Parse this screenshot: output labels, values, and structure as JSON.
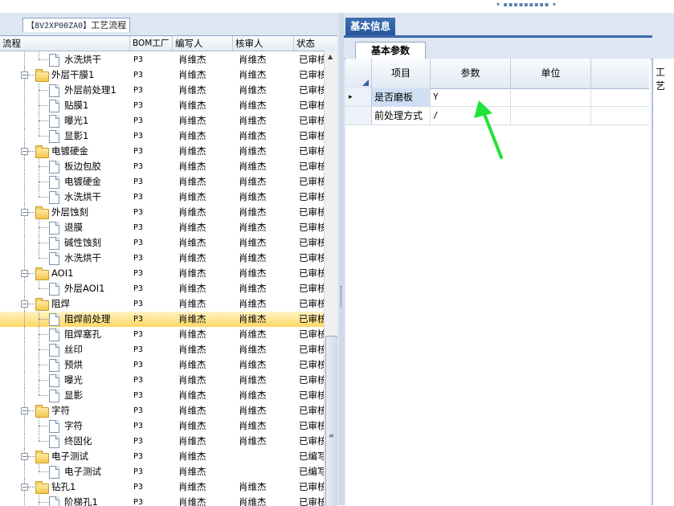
{
  "left_panel": {
    "tab_code": "【8V2XP00ZA0】",
    "tab_label": "工艺流程",
    "columns": [
      "流程",
      "BOM工厂",
      "编写人",
      "核审人",
      "状态"
    ]
  },
  "tree_rows": [
    {
      "level": 2,
      "kind": "doc",
      "name": "水洗烘干",
      "bom": "P3",
      "writer": "肖维杰",
      "reviewer": "肖维杰",
      "status": "已审核",
      "last": true
    },
    {
      "level": 1,
      "kind": "folder",
      "name": "外层干膜1",
      "bom": "P3",
      "writer": "肖维杰",
      "reviewer": "肖维杰",
      "status": "已审核"
    },
    {
      "level": 2,
      "kind": "doc",
      "name": "外层前处理1",
      "bom": "P3",
      "writer": "肖维杰",
      "reviewer": "肖维杰",
      "status": "已审核"
    },
    {
      "level": 2,
      "kind": "doc",
      "name": "贴膜1",
      "bom": "P3",
      "writer": "肖维杰",
      "reviewer": "肖维杰",
      "status": "已审核"
    },
    {
      "level": 2,
      "kind": "doc",
      "name": "曝光1",
      "bom": "P3",
      "writer": "肖维杰",
      "reviewer": "肖维杰",
      "status": "已审核"
    },
    {
      "level": 2,
      "kind": "doc",
      "name": "显影1",
      "bom": "P3",
      "writer": "肖维杰",
      "reviewer": "肖维杰",
      "status": "已审核",
      "last": true
    },
    {
      "level": 1,
      "kind": "folder",
      "name": "电镀硬金",
      "bom": "P3",
      "writer": "肖维杰",
      "reviewer": "肖维杰",
      "status": "已审核"
    },
    {
      "level": 2,
      "kind": "doc",
      "name": "板边包胶",
      "bom": "P3",
      "writer": "肖维杰",
      "reviewer": "肖维杰",
      "status": "已审核"
    },
    {
      "level": 2,
      "kind": "doc",
      "name": "电镀硬金",
      "bom": "P3",
      "writer": "肖维杰",
      "reviewer": "肖维杰",
      "status": "已审核"
    },
    {
      "level": 2,
      "kind": "doc",
      "name": "水洗烘干",
      "bom": "P3",
      "writer": "肖维杰",
      "reviewer": "肖维杰",
      "status": "已审核",
      "last": true
    },
    {
      "level": 1,
      "kind": "folder",
      "name": "外层蚀刻",
      "bom": "P3",
      "writer": "肖维杰",
      "reviewer": "肖维杰",
      "status": "已审核"
    },
    {
      "level": 2,
      "kind": "doc",
      "name": "退膜",
      "bom": "P3",
      "writer": "肖维杰",
      "reviewer": "肖维杰",
      "status": "已审核"
    },
    {
      "level": 2,
      "kind": "doc",
      "name": "碱性蚀刻",
      "bom": "P3",
      "writer": "肖维杰",
      "reviewer": "肖维杰",
      "status": "已审核"
    },
    {
      "level": 2,
      "kind": "doc",
      "name": "水洗烘干",
      "bom": "P3",
      "writer": "肖维杰",
      "reviewer": "肖维杰",
      "status": "已审核",
      "last": true
    },
    {
      "level": 1,
      "kind": "folder",
      "name": "AOI1",
      "bom": "P3",
      "writer": "肖维杰",
      "reviewer": "肖维杰",
      "status": "已审核"
    },
    {
      "level": 2,
      "kind": "doc",
      "name": "外层AOI1",
      "bom": "P3",
      "writer": "肖维杰",
      "reviewer": "肖维杰",
      "status": "已审核",
      "last": true
    },
    {
      "level": 1,
      "kind": "folder",
      "name": "阻焊",
      "bom": "P3",
      "writer": "肖维杰",
      "reviewer": "肖维杰",
      "status": "已审核"
    },
    {
      "level": 2,
      "kind": "doc",
      "name": "阻焊前处理",
      "bom": "P3",
      "writer": "肖维杰",
      "reviewer": "肖维杰",
      "status": "已审核",
      "selected": true
    },
    {
      "level": 2,
      "kind": "doc",
      "name": "阻焊塞孔",
      "bom": "P3",
      "writer": "肖维杰",
      "reviewer": "肖维杰",
      "status": "已审核"
    },
    {
      "level": 2,
      "kind": "doc",
      "name": "丝印",
      "bom": "P3",
      "writer": "肖维杰",
      "reviewer": "肖维杰",
      "status": "已审核"
    },
    {
      "level": 2,
      "kind": "doc",
      "name": "预烘",
      "bom": "P3",
      "writer": "肖维杰",
      "reviewer": "肖维杰",
      "status": "已审核"
    },
    {
      "level": 2,
      "kind": "doc",
      "name": "曝光",
      "bom": "P3",
      "writer": "肖维杰",
      "reviewer": "肖维杰",
      "status": "已审核"
    },
    {
      "level": 2,
      "kind": "doc",
      "name": "显影",
      "bom": "P3",
      "writer": "肖维杰",
      "reviewer": "肖维杰",
      "status": "已审核",
      "last": true
    },
    {
      "level": 1,
      "kind": "folder",
      "name": "字符",
      "bom": "P3",
      "writer": "肖维杰",
      "reviewer": "肖维杰",
      "status": "已审核"
    },
    {
      "level": 2,
      "kind": "doc",
      "name": "字符",
      "bom": "P3",
      "writer": "肖维杰",
      "reviewer": "肖维杰",
      "status": "已审核"
    },
    {
      "level": 2,
      "kind": "doc",
      "name": "终固化",
      "bom": "P3",
      "writer": "肖维杰",
      "reviewer": "肖维杰",
      "status": "已审核",
      "last": true
    },
    {
      "level": 1,
      "kind": "folder",
      "name": "电子测试",
      "bom": "P3",
      "writer": "肖维杰",
      "reviewer": "",
      "status": "已编写"
    },
    {
      "level": 2,
      "kind": "doc",
      "name": "电子测试",
      "bom": "P3",
      "writer": "肖维杰",
      "reviewer": "",
      "status": "已编写",
      "last": true
    },
    {
      "level": 1,
      "kind": "folder",
      "name": "钻孔1",
      "bom": "P3",
      "writer": "肖维杰",
      "reviewer": "肖维杰",
      "status": "已审核"
    },
    {
      "level": 2,
      "kind": "doc",
      "name": "阶梯孔1",
      "bom": "P3",
      "writer": "肖维杰",
      "reviewer": "肖维杰",
      "status": "已审核"
    }
  ],
  "right_panel": {
    "tab_label": "基本信息",
    "subtab_label": "基本参数",
    "columns": [
      "项目",
      "参数",
      "单位"
    ],
    "rows": [
      {
        "item": "是否磨板",
        "param": "Y",
        "unit": ""
      },
      {
        "item": "前处理方式",
        "param": "/",
        "unit": ""
      }
    ]
  },
  "far_right": {
    "label": "工艺"
  },
  "colors": {
    "tab_blue": "#2f62a8",
    "selection": "#ffd766",
    "arrow": "#22e33a"
  }
}
